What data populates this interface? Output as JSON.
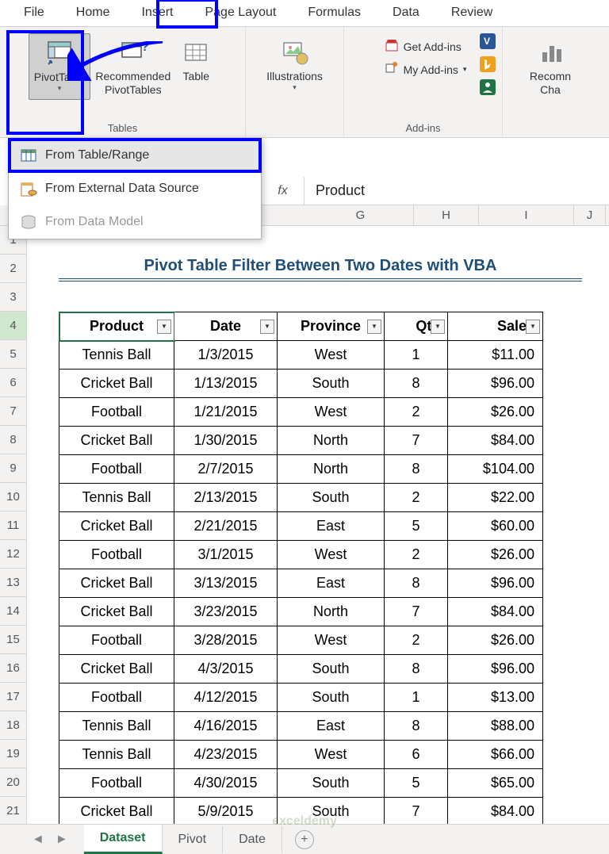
{
  "ribbon": {
    "tabs": [
      "File",
      "Home",
      "Insert",
      "Page Layout",
      "Formulas",
      "Data",
      "Review"
    ],
    "active_tab": "Insert",
    "pivot_table_label": "PivotTable",
    "recommended_label": "Recommended\nPivotTables",
    "table_label": "Table",
    "tables_group": "Tables",
    "illustrations_label": "Illustrations",
    "get_addins": "Get Add-ins",
    "my_addins": "My Add-ins",
    "addins_group": "Add-ins",
    "recommended_charts": "Recomn\nCha"
  },
  "dropdown": {
    "from_table": "From Table/Range",
    "from_external": "From External Data Source",
    "from_model": "From Data Model"
  },
  "formula": {
    "fx": "fx",
    "value": "Product"
  },
  "columns": [
    "G",
    "H",
    "I",
    "J"
  ],
  "rows": [
    "1",
    "2",
    "3",
    "4",
    "5",
    "6",
    "7",
    "8",
    "9",
    "10",
    "11",
    "12",
    "13",
    "14",
    "15",
    "16",
    "17",
    "18",
    "19",
    "20",
    "21"
  ],
  "title": "Pivot Table Filter Between Two Dates with VBA",
  "headers": {
    "product": "Product",
    "date": "Date",
    "province": "Province",
    "qty": "Qty.",
    "sales": "Sales"
  },
  "data": [
    {
      "product": "Tennis Ball",
      "date": "1/3/2015",
      "province": "West",
      "qty": "1",
      "sales": "$11.00"
    },
    {
      "product": "Cricket Ball",
      "date": "1/13/2015",
      "province": "South",
      "qty": "8",
      "sales": "$96.00"
    },
    {
      "product": "Football",
      "date": "1/21/2015",
      "province": "West",
      "qty": "2",
      "sales": "$26.00"
    },
    {
      "product": "Cricket Ball",
      "date": "1/30/2015",
      "province": "North",
      "qty": "7",
      "sales": "$84.00"
    },
    {
      "product": "Football",
      "date": "2/7/2015",
      "province": "North",
      "qty": "8",
      "sales": "$104.00"
    },
    {
      "product": "Tennis Ball",
      "date": "2/13/2015",
      "province": "South",
      "qty": "2",
      "sales": "$22.00"
    },
    {
      "product": "Cricket Ball",
      "date": "2/21/2015",
      "province": "East",
      "qty": "5",
      "sales": "$60.00"
    },
    {
      "product": "Football",
      "date": "3/1/2015",
      "province": "West",
      "qty": "2",
      "sales": "$26.00"
    },
    {
      "product": "Cricket Ball",
      "date": "3/13/2015",
      "province": "East",
      "qty": "8",
      "sales": "$96.00"
    },
    {
      "product": "Cricket Ball",
      "date": "3/23/2015",
      "province": "North",
      "qty": "7",
      "sales": "$84.00"
    },
    {
      "product": "Football",
      "date": "3/28/2015",
      "province": "West",
      "qty": "2",
      "sales": "$26.00"
    },
    {
      "product": "Cricket Ball",
      "date": "4/3/2015",
      "province": "South",
      "qty": "8",
      "sales": "$96.00"
    },
    {
      "product": "Football",
      "date": "4/12/2015",
      "province": "South",
      "qty": "1",
      "sales": "$13.00"
    },
    {
      "product": "Tennis Ball",
      "date": "4/16/2015",
      "province": "East",
      "qty": "8",
      "sales": "$88.00"
    },
    {
      "product": "Tennis Ball",
      "date": "4/23/2015",
      "province": "West",
      "qty": "6",
      "sales": "$66.00"
    },
    {
      "product": "Football",
      "date": "4/30/2015",
      "province": "South",
      "qty": "5",
      "sales": "$65.00"
    },
    {
      "product": "Cricket Ball",
      "date": "5/9/2015",
      "province": "South",
      "qty": "7",
      "sales": "$84.00"
    }
  ],
  "sheets": {
    "nav_prev": "◄",
    "nav_next": "►",
    "tabs": [
      "Dataset",
      "Pivot",
      "Date"
    ],
    "active": "Dataset",
    "add": "+"
  },
  "watermark": "exceldemy"
}
